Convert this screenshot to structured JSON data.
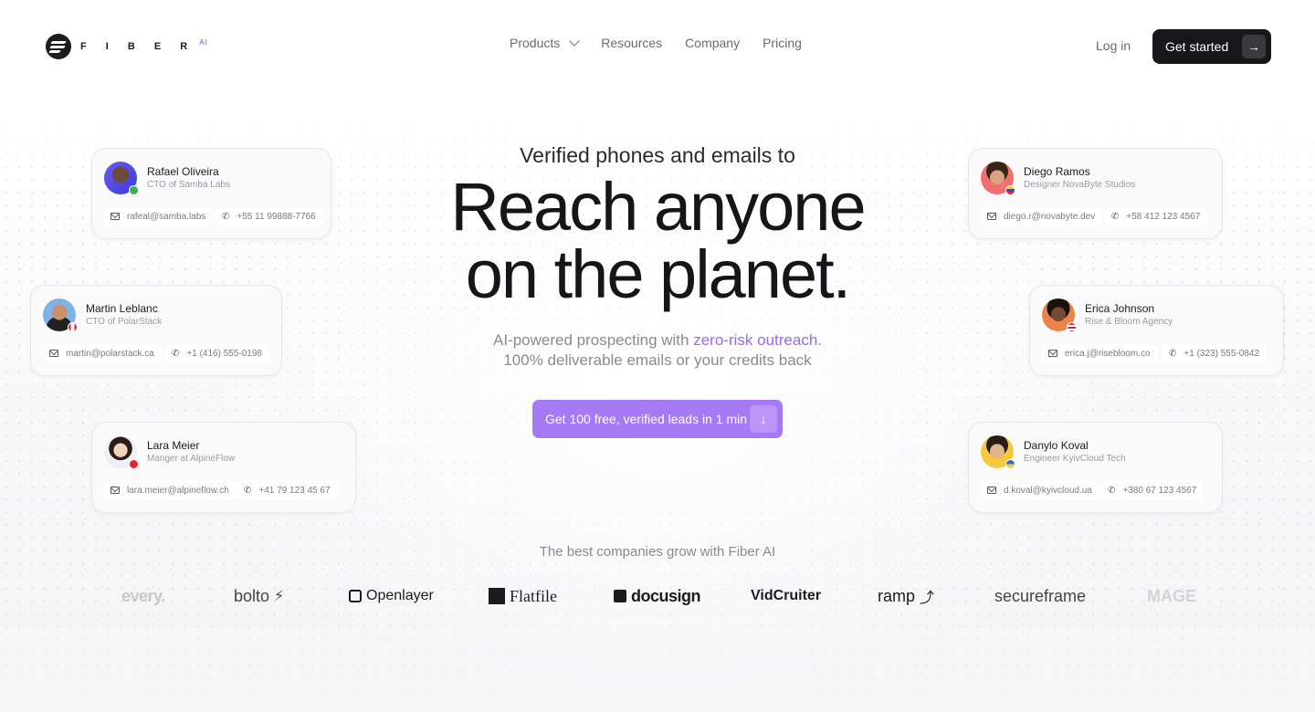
{
  "nav": {
    "brand": "F I B E R",
    "brand_sup": "AI",
    "links": [
      "Products",
      "Resources",
      "Company",
      "Pricing"
    ],
    "login": "Log in",
    "cta": "Get started"
  },
  "hero": {
    "subtitle": "Verified phones and emails to",
    "title_line1": "Reach anyone",
    "title_line2": "on the planet.",
    "desc_pre": "AI-powered prospecting with ",
    "desc_accent": "zero-risk outreach",
    "desc_post": ".",
    "desc_line2": "100% deliverable emails or your credits back",
    "cta": "Get 100 free, verified leads in 1 min"
  },
  "colors": {
    "accent": "#a77af5",
    "accent_text": "#9a6af0",
    "dark": "#18181a"
  },
  "cards": [
    {
      "name": "Rafael Oliveira",
      "role": "CTO of Samba Labs",
      "email": "rafeal@samba.labs",
      "phone": "+55 11 99888-7766",
      "flag": "brazil"
    },
    {
      "name": "Martin Leblanc",
      "role": "CTO of PolarStack",
      "email": "martin@polarstack.ca",
      "phone": "+1 (416) 555-0198",
      "flag": "canada"
    },
    {
      "name": "Lara Meier",
      "role": "Manger at AlpineFlow",
      "email": "lara.meier@alpineflow.ch",
      "phone": "+41 79 123 45 67",
      "flag": "switzerland"
    },
    {
      "name": "Diego Ramos",
      "role": "Designer NovaByte Studios",
      "email": "diego.r@novabyte.dev",
      "phone": "+58 412 123 4567",
      "flag": "venezuela"
    },
    {
      "name": "Erica Johnson",
      "role": "Rise & Bloom Agency",
      "email": "erica.j@risebloom.co",
      "phone": "+1 (323) 555-0842",
      "flag": "usa"
    },
    {
      "name": "Danylo Koval",
      "role": "Engineer KyivCloud Tech",
      "email": "d.koval@kyivcloud.ua",
      "phone": "+380 67 123 4567",
      "flag": "ukraine"
    }
  ],
  "companies": {
    "heading": "The best companies grow with Fiber AI",
    "logos": [
      "every.",
      "bolto",
      "Openlayer",
      "Flatfile",
      "docusign",
      "VidCruiter",
      "ramp",
      "secureframe",
      "MAGE"
    ]
  }
}
